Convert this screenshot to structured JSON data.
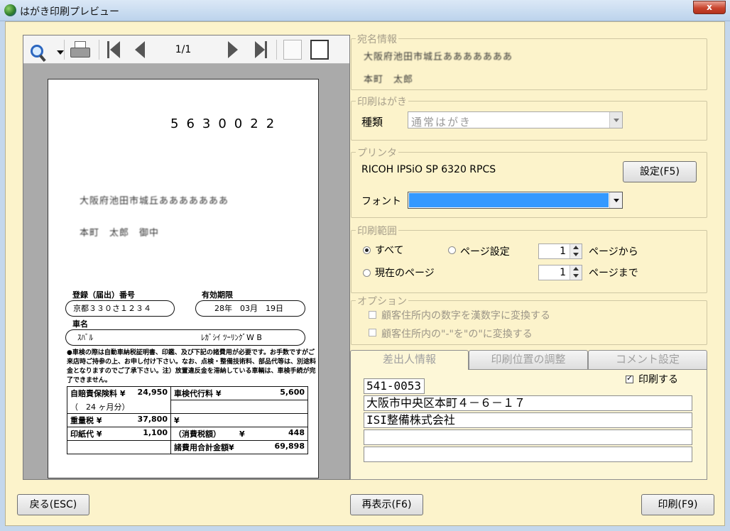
{
  "window": {
    "title": "はがき印刷プレビュー",
    "close_label": "x"
  },
  "toolbar": {
    "page_counter": "1/1"
  },
  "postcard": {
    "zip": "5630022",
    "address": "大阪府池田市城丘あああああああ",
    "recipient": "本町　太郎　御中",
    "reg_label": "登録（届出）番号",
    "reg_value": "京都３３０さ１２３４",
    "expiry_label": "有効期限",
    "expiry_value": "28年　03月　19日",
    "car_label": "車名",
    "car_maker": "ｽﾊﾞﾙ",
    "car_model": "ﾚｶﾞｼｲ ﾂｰﾘﾝｸﾞW B",
    "notice": "●車検の際は自動車納税証明書、印鑑、及び下記の諸費用が必要です。お手数ですがご来店時ご持参の上、お申し付け下さい。なお、点検・整備技術料、部品代等は、別途料金となりますのでご了承下さい。注）放置違反金を滞納している車輌は、車検手続が完了できません。",
    "fees": {
      "insurance_label": "自賠責保険料 ¥",
      "insurance_value": "24,950",
      "insurance_months": "（　24 ヶ月分）",
      "inspection_label": "車検代行料 ¥",
      "inspection_value": "5,600",
      "weight_tax_label": "重量税 ¥",
      "weight_tax_value": "37,800",
      "yen_blank": "¥",
      "stamp_label": "印紙代 ¥",
      "stamp_value": "1,100",
      "consumption_tax_label": "（消費税額）",
      "consumption_tax_yen": "¥",
      "consumption_tax_value": "448",
      "total_label": "諸費用合計金額¥",
      "total_value": "69,898"
    }
  },
  "address_info": {
    "legend": "宛名情報",
    "address_line": "大阪府池田市城丘あああああああ",
    "name_line": "本町　太郎"
  },
  "print_card": {
    "legend": "印刷はがき",
    "type_label": "種類",
    "type_value": "通常はがき"
  },
  "printer": {
    "legend": "プリンタ",
    "name": "RICOH IPSiO SP 6320 RPCS",
    "settings_button": "設定(F5)",
    "font_label": "フォント",
    "font_value": ""
  },
  "print_range": {
    "legend": "印刷範囲",
    "all": "すべて",
    "page_setting": "ページ設定",
    "current_page": "現在のページ",
    "from_value": "1",
    "from_suffix": "ページから",
    "to_value": "1",
    "to_suffix": "ページまで"
  },
  "options": {
    "legend": "オプション",
    "opt1": "顧客住所内の数字を漢数字に変換する",
    "opt2": "顧客住所内の\"-\"を\"の\"に変換する"
  },
  "tabs": [
    "差出人情報",
    "印刷位置の調整",
    "コメント設定"
  ],
  "sender": {
    "print_label": "印刷する",
    "zip": "541-0053",
    "address": "大阪市中央区本町４－６－１７",
    "company": "ISI整備株式会社",
    "line4": "",
    "line5": ""
  },
  "footer": {
    "back_button": "戻る(ESC)",
    "refresh_button": "再表示(F6)",
    "print_button": "印刷(F9)"
  },
  "colors": {
    "client_bg": "#fcf3cb",
    "font_combo_highlight": "#3399ff",
    "close_button": "#c9452e"
  }
}
